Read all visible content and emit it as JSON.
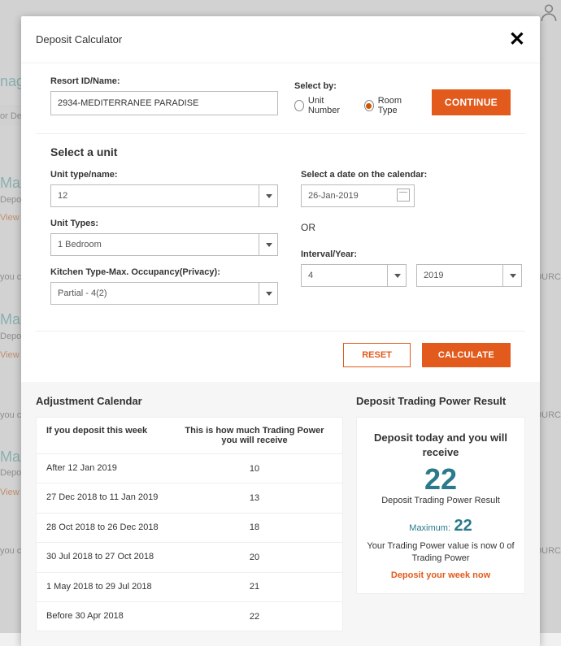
{
  "modal": {
    "title": "Deposit Calculator",
    "close": "✕"
  },
  "resort": {
    "label": "Resort ID/Name:",
    "value": "2934-MEDITERRANEE PARADISE"
  },
  "selectby": {
    "label": "Select by:",
    "opt1": "Unit Number",
    "opt2": "Room Type"
  },
  "buttons": {
    "continue": "CONTINUE",
    "reset": "RESET",
    "calculate": "CALCULATE"
  },
  "unit": {
    "section_title": "Select a unit",
    "type_name_label": "Unit type/name:",
    "type_name_value": "12",
    "unit_types_label": "Unit Types:",
    "unit_types_value": "1 Bedroom",
    "kitchen_label": "Kitchen Type-Max. Occupancy(Privacy):",
    "kitchen_value": "Partial - 4(2)"
  },
  "date": {
    "label": "Select a date on the calendar:",
    "value": "26-Jan-2019",
    "or": "OR",
    "interval_label": "Interval/Year:",
    "interval_value": "4",
    "year_value": "2019"
  },
  "adjustment": {
    "title": "Adjustment Calendar",
    "col1": "If you deposit this week",
    "col2": "This is how much Trading Power you will receive",
    "rows": [
      {
        "period": "After 12 Jan 2019",
        "power": "10"
      },
      {
        "period": "27 Dec 2018 to 11 Jan 2019",
        "power": "13"
      },
      {
        "period": "28 Oct 2018 to 26 Dec 2018",
        "power": "18"
      },
      {
        "period": "30 Jul 2018 to 27 Oct 2018",
        "power": "20"
      },
      {
        "period": "1 May 2018 to 29 Jul 2018",
        "power": "21"
      },
      {
        "period": "Before 30 Apr 2018",
        "power": "22"
      }
    ]
  },
  "result": {
    "title": "Deposit Trading Power Result",
    "heading": "Deposit today and you will receive",
    "big_value": "22",
    "subtitle": "Deposit Trading Power Result",
    "max_label": "Maximum:",
    "max_value": "22",
    "text": "Your Trading Power value is now 0 of Trading Power",
    "link": "Deposit your week now"
  },
  "bg": {
    "nag": "nag",
    "ordep": "or Dep",
    "max": "Max",
    "deposit": "Deposit",
    "viewp": "View Pr",
    "youc": "you c",
    "ourc": "OURC"
  }
}
